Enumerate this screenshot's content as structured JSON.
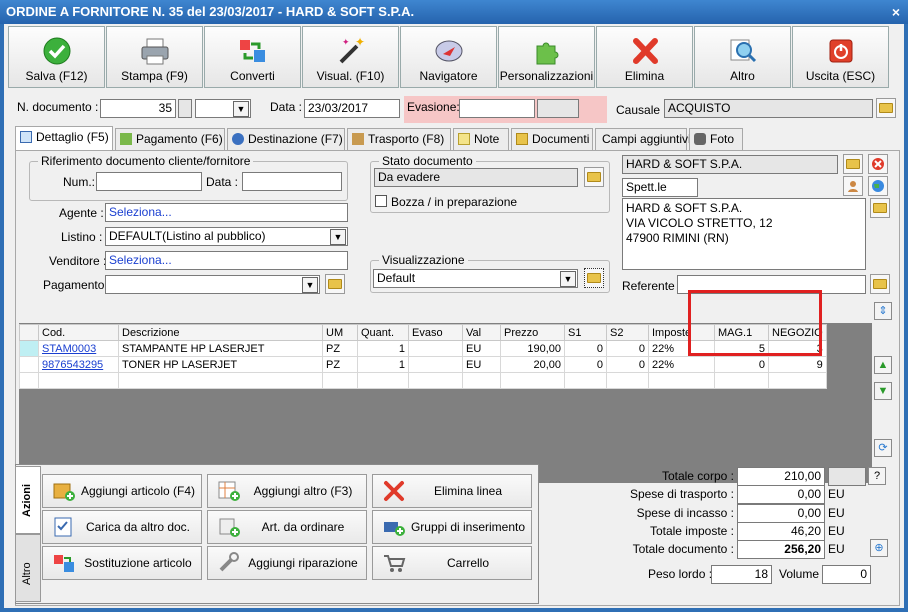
{
  "window": {
    "title": "ORDINE A FORNITORE N. 35 del 23/03/2017 - HARD & SOFT S.P.A.",
    "close": "×"
  },
  "toolbar": [
    {
      "label": "Salva (F12)",
      "icon": "check-icon"
    },
    {
      "label": "Stampa (F9)",
      "icon": "printer-icon"
    },
    {
      "label": "Converti",
      "icon": "convert-icon"
    },
    {
      "label": "Visual. (F10)",
      "icon": "magic-wand-icon"
    },
    {
      "label": "Navigatore",
      "icon": "compass-icon"
    },
    {
      "label": "Personalizzazioni",
      "icon": "puzzle-icon"
    },
    {
      "label": "Elimina",
      "icon": "delete-x-icon"
    },
    {
      "label": "Altro",
      "icon": "search-zoom-icon"
    },
    {
      "label": "Uscita (ESC)",
      "icon": "power-icon"
    }
  ],
  "header": {
    "ndoc_label": "N. documento :",
    "ndoc_value": "35",
    "data_label": "Data :",
    "data_value": "23/03/2017",
    "evasione_label": "Evasione:",
    "causale_label": "Causale :",
    "causale_value": "ACQUISTO"
  },
  "tabs": [
    "Dettaglio (F5)",
    "Pagamento (F6)",
    "Destinazione (F7)",
    "Trasporto (F8)",
    "Note",
    "Documenti",
    "Campi aggiuntivi",
    "Foto"
  ],
  "riferimento": {
    "title": "Riferimento documento cliente/fornitore",
    "num_label": "Num.:",
    "data_label": "Data :"
  },
  "stato": {
    "title": "Stato documento",
    "value": "Da evadere",
    "bozza_label": "Bozza / in preparazione"
  },
  "form": {
    "agente_label": "Agente :",
    "agente_value": "Seleziona...",
    "listino_label": "Listino :",
    "listino_value": "DEFAULT(Listino al pubblico)",
    "venditore_label": "Venditore :",
    "venditore_value": "Seleziona...",
    "pagamento_label": "Pagamento :"
  },
  "visualizzazione": {
    "title": "Visualizzazione",
    "value": "Default"
  },
  "fornitore": {
    "name": "HARD & SOFT S.P.A.",
    "prefix": "Spett.le",
    "address_lines": [
      "HARD & SOFT S.P.A.",
      "VIA VICOLO STRETTO, 12",
      "47900 RIMINI (RN)"
    ],
    "referente_label": "Referente"
  },
  "grid": {
    "headers": [
      "Cod.",
      "Descrizione",
      "UM",
      "Quant.",
      "Evaso",
      "Val",
      "Prezzo",
      "S1",
      "S2",
      "Imposte",
      "MAG.1",
      "NEGOZIO"
    ],
    "rows": [
      [
        "STAM0003",
        "STAMPANTE HP LASERJET",
        "PZ",
        "1",
        "",
        "EU",
        "190,00",
        "0",
        "0",
        "22%",
        "5",
        "3"
      ],
      [
        "9876543295",
        "TONER HP LASERJET",
        "PZ",
        "1",
        "",
        "EU",
        "20,00",
        "0",
        "0",
        "22%",
        "0",
        "9"
      ]
    ]
  },
  "azioni": {
    "side_tabs": [
      "Azioni",
      "Altro"
    ],
    "buttons": [
      {
        "label": "Aggiungi articolo (F4)",
        "icon": "add-box-icon"
      },
      {
        "label": "Aggiungi altro (F3)",
        "icon": "add-grid-icon"
      },
      {
        "label": "Elimina linea",
        "icon": "delete-x-icon"
      },
      {
        "label": "Carica da altro doc.",
        "icon": "checklist-icon"
      },
      {
        "label": "Art. da ordinare",
        "icon": "order-icon"
      },
      {
        "label": "Gruppi di inserimento",
        "icon": "group-add-icon"
      },
      {
        "label": "Sostituzione articolo",
        "icon": "swap-icon"
      },
      {
        "label": "Aggiungi riparazione",
        "icon": "wrench-icon"
      },
      {
        "label": "Carrello",
        "icon": "cart-icon"
      }
    ]
  },
  "totali": {
    "corpo_label": "Totale corpo :",
    "corpo_value": "210,00",
    "trasporto_label": "Spese di trasporto :",
    "trasporto_value": "0,00",
    "incasso_label": "Spese di incasso :",
    "incasso_value": "0,00",
    "imposte_label": "Totale imposte :",
    "imposte_value": "46,20",
    "documento_label": "Totale documento :",
    "documento_value": "256,20",
    "currency": "EU",
    "help": "?",
    "peso_label": "Peso lordo :",
    "peso_value": "18",
    "volume_label": "Volume :",
    "volume_value": "0"
  },
  "colors": {
    "title_bar": "#2f6fb5",
    "highlight_box": "#e02020",
    "evasione_bg": "#f6c6c6",
    "link": "#1a3fd0"
  }
}
